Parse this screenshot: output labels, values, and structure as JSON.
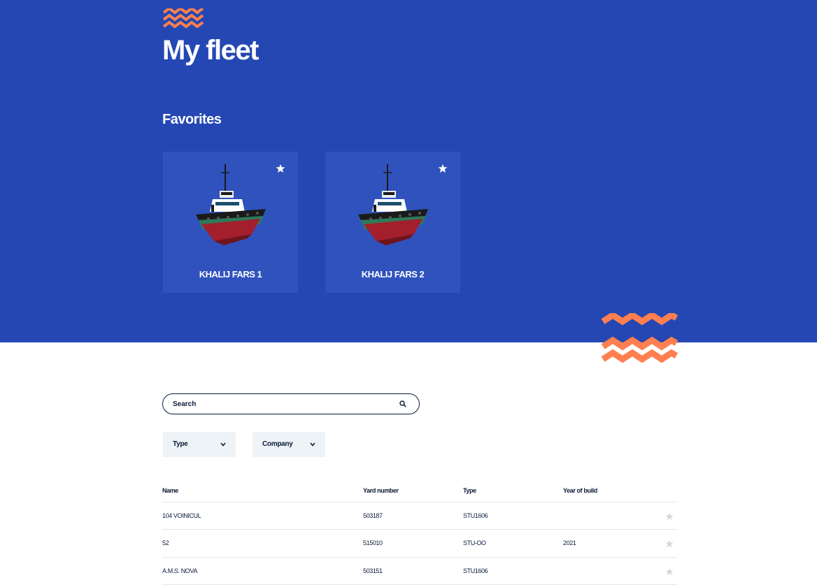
{
  "header": {
    "title": "My fleet",
    "favorites_heading": "Favorites"
  },
  "favorites": [
    {
      "name": "KHALIJ FARS 1",
      "favorite": true
    },
    {
      "name": "KHALIJ FARS 2",
      "favorite": true
    }
  ],
  "search": {
    "placeholder": "Search"
  },
  "filters": [
    {
      "label": "Type"
    },
    {
      "label": "Company"
    }
  ],
  "table": {
    "columns": [
      "Name",
      "Yard number",
      "Type",
      "Year of build"
    ],
    "rows": [
      {
        "name": "104 VOINICUL",
        "yard_number": "503187",
        "type": "STU1606",
        "year": "",
        "favorite": false
      },
      {
        "name": "52",
        "yard_number": "515010",
        "type": "STU-OO",
        "year": "2021",
        "favorite": false
      },
      {
        "name": "A.M.S. NOVA",
        "yard_number": "503151",
        "type": "STU1606",
        "year": "",
        "favorite": false
      }
    ]
  },
  "colors": {
    "hero_blue": "#2447b3",
    "card_blue": "#3052bd",
    "accent_orange": "#ff7f50",
    "text_navy": "#0b1a3a"
  },
  "icons": [
    "zigzag-logo-icon",
    "star-icon",
    "tugboat-image",
    "search-icon",
    "chevron-down-icon",
    "zigzag-decoration-icon"
  ]
}
